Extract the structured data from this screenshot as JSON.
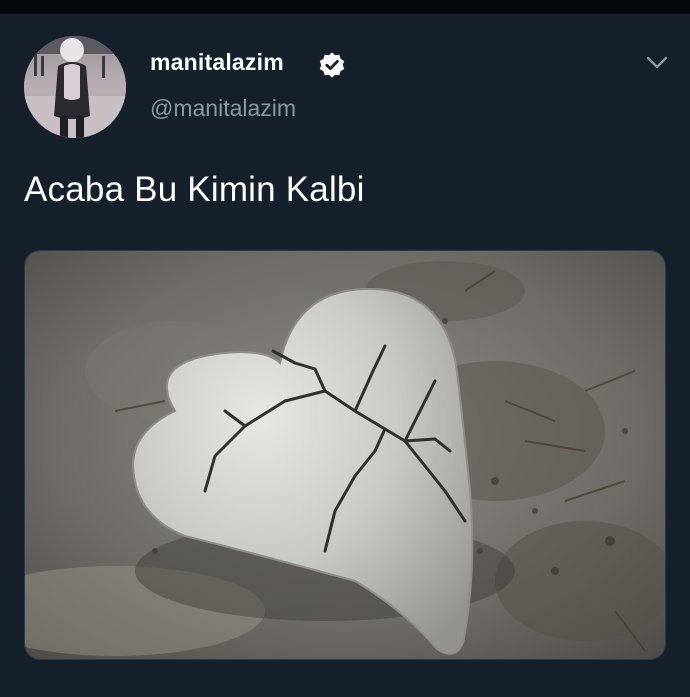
{
  "tweet": {
    "author": {
      "display_name": "manitalazim",
      "handle": "@manitalazim",
      "verified": true,
      "avatar_icon": "profile-photo"
    },
    "text": "Acaba Bu Kimin Kalbi",
    "media": {
      "icon": "cracked-stone-heart-photo"
    },
    "menu_icon": "chevron-down-icon"
  },
  "colors": {
    "background": "#15202b",
    "primary_text": "#ffffff",
    "secondary_text": "#8899a6",
    "top_bar": "#05080b"
  }
}
